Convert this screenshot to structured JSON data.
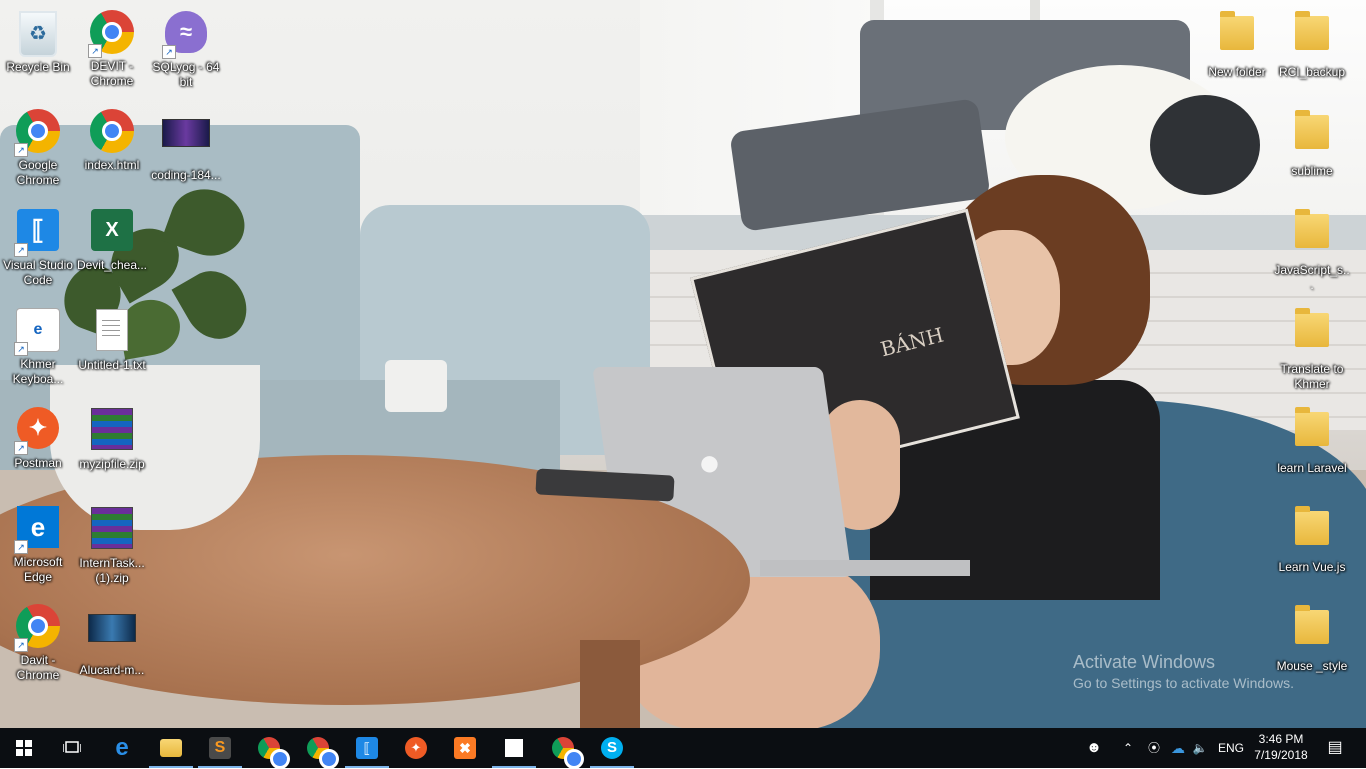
{
  "desktop": {
    "icons": [
      {
        "id": "recycle-bin",
        "label": "Recycle Bin",
        "icon": "recycle-bin-icon"
      },
      {
        "id": "devit-chrome",
        "label": "DEVIT - Chrome",
        "icon": "chrome-icon"
      },
      {
        "id": "sqlyog",
        "label": "SQLyog - 64 bit",
        "icon": "sqlyog-dolphin-icon"
      },
      {
        "id": "google-chrome",
        "label": "Google Chrome",
        "icon": "chrome-icon"
      },
      {
        "id": "index-html",
        "label": "index.html",
        "icon": "chrome-icon"
      },
      {
        "id": "coding",
        "label": "coding-184...",
        "icon": "image-thumbnail-icon"
      },
      {
        "id": "vscode",
        "label": "Visual Studio Code",
        "icon": "vscode-icon"
      },
      {
        "id": "devit-chea",
        "label": "Devit_chea...",
        "icon": "excel-icon"
      },
      {
        "id": "khmer-keyboard",
        "label": "Khmer Keyboa...",
        "icon": "pdf-edge-icon"
      },
      {
        "id": "untitled-1",
        "label": "Untitled-1.txt",
        "icon": "text-file-icon"
      },
      {
        "id": "postman",
        "label": "Postman",
        "icon": "postman-icon"
      },
      {
        "id": "myzipfile",
        "label": "myzipfile.zip",
        "icon": "winrar-icon"
      },
      {
        "id": "ms-edge",
        "label": "Microsoft Edge",
        "icon": "edge-icon"
      },
      {
        "id": "interntask",
        "label": "InternTask... (1).zip",
        "icon": "winrar-icon"
      },
      {
        "id": "davit-chrome",
        "label": "Davit - Chrome",
        "icon": "chrome-profile-icon"
      },
      {
        "id": "alucard",
        "label": "Alucard-m...",
        "icon": "image-thumbnail-icon"
      },
      {
        "id": "new-folder",
        "label": "New folder",
        "icon": "folder-icon"
      },
      {
        "id": "rci-backup",
        "label": "RCI_backup",
        "icon": "folder-icon"
      },
      {
        "id": "sublime",
        "label": "sublime",
        "icon": "folder-icon"
      },
      {
        "id": "javascript",
        "label": "JavaScript_s...",
        "icon": "folder-icon"
      },
      {
        "id": "translate-khmer",
        "label": "Translate to Khmer",
        "icon": "folder-icon"
      },
      {
        "id": "learn-laravel",
        "label": "learn Laravel",
        "icon": "folder-icon"
      },
      {
        "id": "learn-vue",
        "label": "Learn Vue.js",
        "icon": "folder-icon"
      },
      {
        "id": "mouse-style",
        "label": "Mouse _style",
        "icon": "folder-icon"
      }
    ]
  },
  "wallpaper": {
    "book_title": "BÁNH"
  },
  "watermark": {
    "line1": "Activate Windows",
    "line2": "Go to Settings to activate Windows."
  },
  "taskbar": {
    "pinned": [
      {
        "id": "start",
        "icon": "windows-start-icon"
      },
      {
        "id": "task-view",
        "icon": "task-view-icon"
      },
      {
        "id": "edge",
        "icon": "edge-icon"
      },
      {
        "id": "file-explorer",
        "icon": "folder-icon"
      },
      {
        "id": "sublime",
        "icon": "sublime-text-icon"
      },
      {
        "id": "chrome-devit",
        "icon": "chrome-profile-icon"
      },
      {
        "id": "chrome-davit",
        "icon": "chrome-profile-icon"
      },
      {
        "id": "vscode",
        "icon": "vscode-icon"
      },
      {
        "id": "postman",
        "icon": "postman-icon"
      },
      {
        "id": "xampp",
        "icon": "xampp-icon"
      },
      {
        "id": "sticky-notes",
        "icon": "sticky-notes-icon"
      },
      {
        "id": "chrome",
        "icon": "chrome-icon"
      },
      {
        "id": "skype",
        "icon": "skype-icon"
      }
    ],
    "tray": {
      "people_icon": "people-icon",
      "chevron_icon": "chevron-up-icon",
      "wifi_icon": "wifi-icon",
      "onedrive_icon": "onedrive-icon",
      "volume_icon": "volume-icon",
      "language": "ENG",
      "time": "3:46 PM",
      "date": "7/19/2018",
      "notifications_icon": "action-center-icon"
    }
  },
  "colors": {
    "taskbar_bg": "#0b0e12",
    "taskbar_active": "#7eb4ea",
    "folder_yellow": "#f8d775",
    "edge_blue": "#0078d7",
    "postman_orange": "#ef5b25",
    "vscode_blue": "#1e88e5"
  }
}
